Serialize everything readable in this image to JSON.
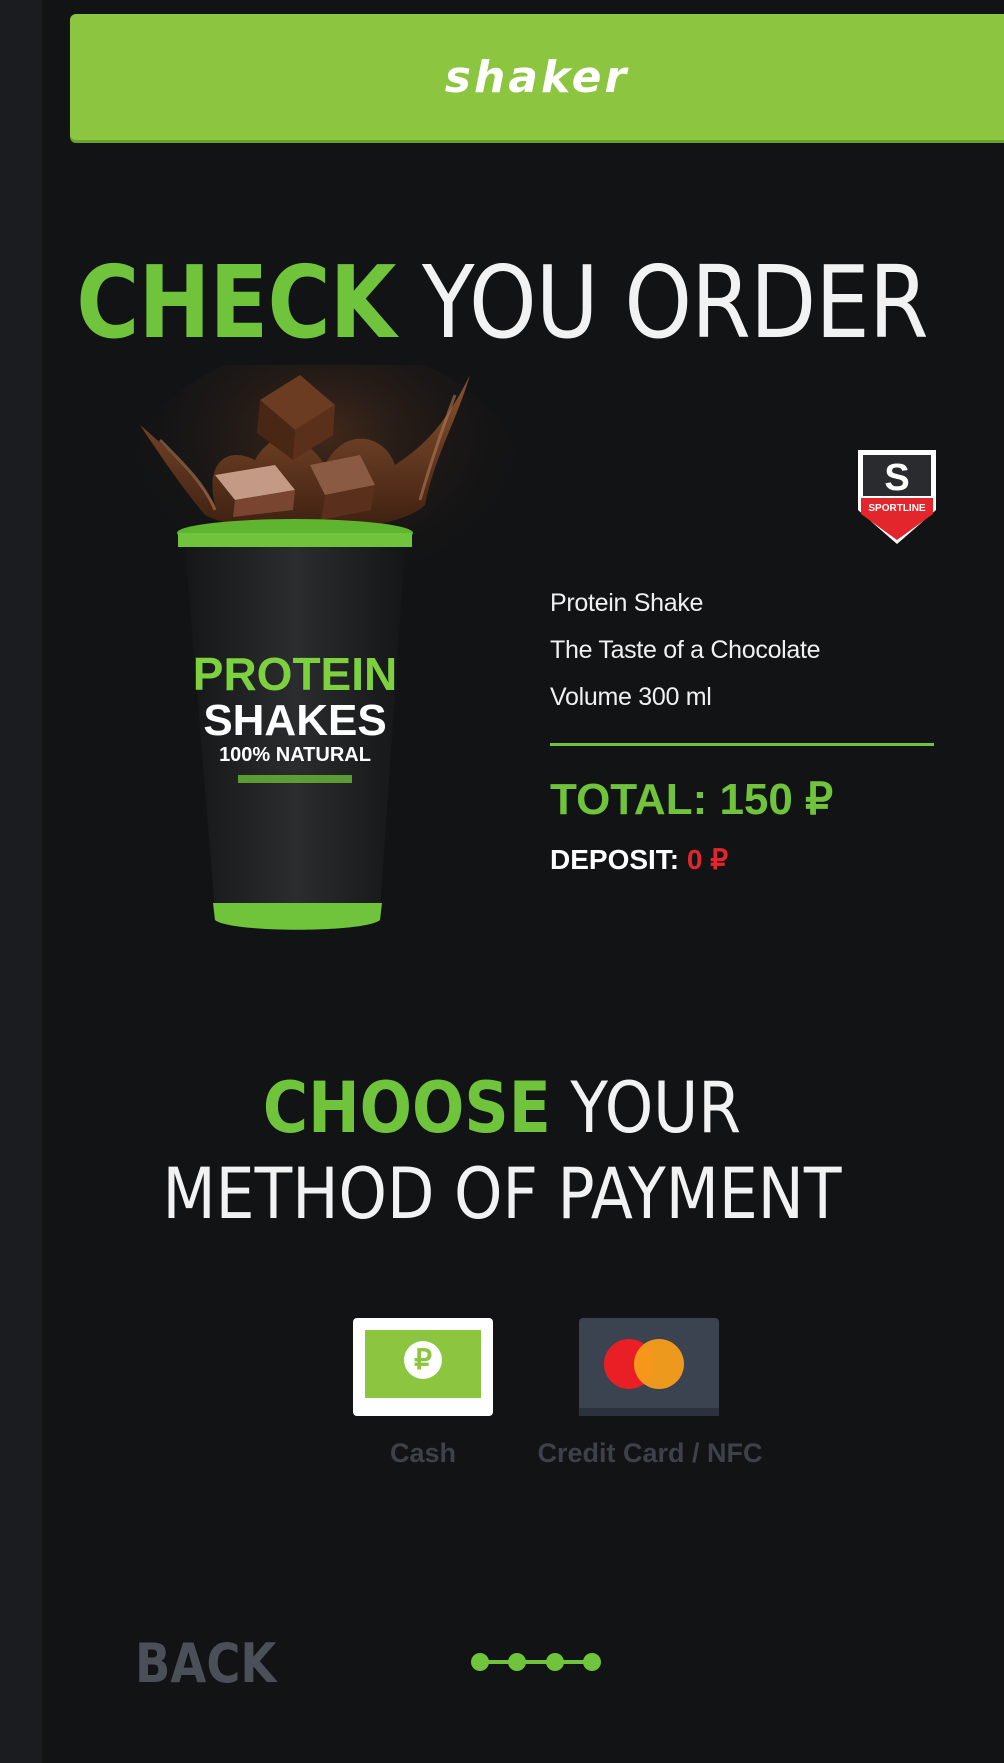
{
  "app": {
    "brand_name": "shaker"
  },
  "order": {
    "title_accent": "CHECK",
    "title_rest": " YOU ORDER",
    "product_lines": [
      "Protein Shake",
      "The Taste of a Chocolate",
      "Volume 300 ml"
    ],
    "total_label": "TOTAL: 150 ₽",
    "deposit_label": "DEPOSIT:",
    "deposit_value": " 0 ₽"
  },
  "product_cup": {
    "line1": "PROTEIN",
    "line2": "SHAKES",
    "line3": "100% NATURAL"
  },
  "brand_badge": {
    "text": "SPORTLINE",
    "letter": "S"
  },
  "payment": {
    "title_accent": "CHOOSE",
    "title_rest_1": " YOUR",
    "title_line2": "METHOD OF PAYMENT",
    "options": [
      {
        "label": "Cash",
        "icon": "ruble-coin-icon"
      },
      {
        "label": "Credit Card / NFC",
        "icon": "mastercard-icon"
      }
    ]
  },
  "nav": {
    "back_label": "BACK",
    "step_count": 4
  },
  "colors": {
    "accent": "#6fc43c",
    "header": "#8cc53f",
    "deposit": "#e3262b",
    "background": "#121315"
  }
}
